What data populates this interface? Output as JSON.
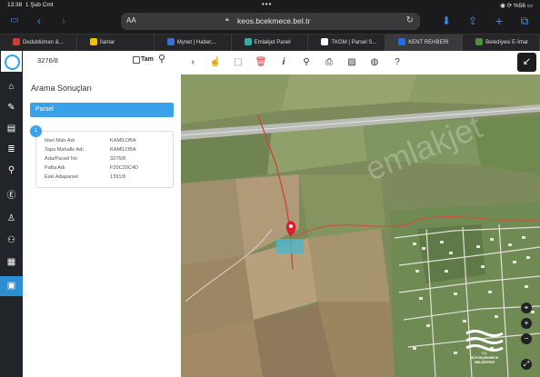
{
  "status": {
    "time": "13:38",
    "date": "1 Şub Cmt",
    "battery": "%56"
  },
  "browser": {
    "aa": "AA",
    "url": "keos.bcekmece.bel.tr"
  },
  "tabs": [
    {
      "label": "Dedublüman &...",
      "color": "#d23b2f"
    },
    {
      "label": "İlanlar",
      "color": "#f2c200"
    },
    {
      "label": "Mynet | Haber,...",
      "color": "#3b6fd8"
    },
    {
      "label": "Emlakjet Panel",
      "color": "#2ab3a5"
    },
    {
      "label": "TKGM | Parsel S...",
      "color": "#ffffff"
    },
    {
      "label": "KENT REHBERİ",
      "color": "#1f6fe0"
    },
    {
      "label": "Belediyesi E-İmar",
      "color": "#4d8f3e"
    }
  ],
  "search": {
    "query": "3276/8",
    "tam_label": "Tam"
  },
  "results": {
    "title": "Arama Sonuçları",
    "category": "Parsel",
    "index": "1",
    "rows": [
      {
        "label": "İdari Mah.Adı",
        "value": "KAMİLOBA"
      },
      {
        "label": "Tapu Mahalle Adı",
        "value": "KAMİLOBA"
      },
      {
        "label": "Ada/Parsel No",
        "value": "3276/8"
      },
      {
        "label": "Pafta Adı",
        "value": "F20C20C4D"
      },
      {
        "label": "Eski Adaparsel",
        "value": "1391/8"
      }
    ]
  },
  "map": {
    "watermark": "emlakjet",
    "logo_line1": "T.C.",
    "logo_line2": "BÜYÜKÇEKMECE",
    "logo_line3": "BELEDİYESİ",
    "accent": "#2c8fd3"
  }
}
